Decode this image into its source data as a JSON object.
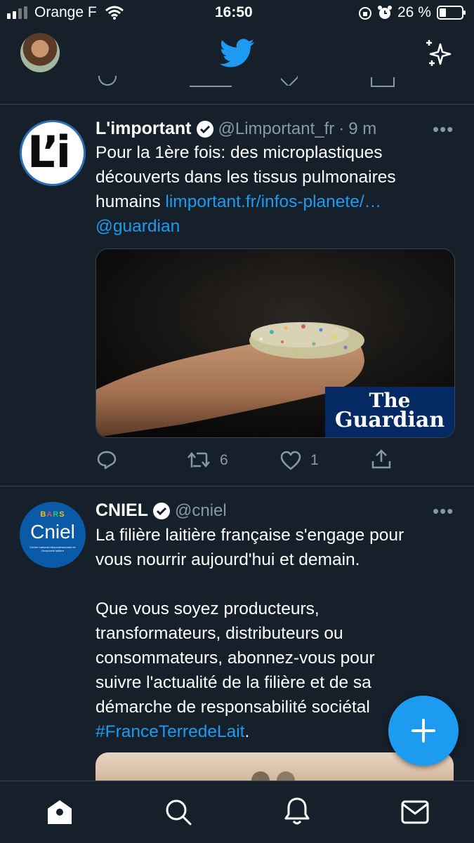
{
  "status_bar": {
    "carrier": "Orange F",
    "time": "16:50",
    "battery": "26 %"
  },
  "colors": {
    "background": "#15202b",
    "accent": "#1d9bf0",
    "divider": "#38444d",
    "secondary_text": "#8899a6"
  },
  "header": {
    "logo_icon": "twitter-bird-icon",
    "sparkle_icon": "sparkle-icon"
  },
  "tweets": [
    {
      "name": "L'important",
      "verified": true,
      "handle": "@Limportant_fr",
      "dot": "·",
      "time": "9 m",
      "more": "•••",
      "avatar_text": "L’i",
      "text_line1": "Pour la 1ère fois: des microplastiques",
      "text_line2": "découverts dans les tissus pulmonaires",
      "text_line3_plain": "humains ",
      "text_link": "limportant.fr/infos-planete/…",
      "text_mention": "@guardian",
      "media_badge_line1": "The",
      "media_badge_line2": "Guardian",
      "retweets": "6",
      "likes": "1"
    },
    {
      "name": "CNIEL",
      "verified": true,
      "handle": "@cniel",
      "more": "•••",
      "avatar_text": "Cniel",
      "avatar_sub": "Centre national interprofessionnel de l'économie laitière",
      "para1_line1": "La filière laitière française s'engage pour",
      "para1_line2": "vous nourrir aujourd'hui et demain.",
      "para2_line1": "Que vous soyez producteurs,",
      "para2_line2": "transformateurs, distributeurs ou",
      "para2_line3": "consommateurs, abonnez-vous pour",
      "para2_line4": "suivre l'actualité de la filière et de sa",
      "para2_line5": "démarche de responsabilité sociétal",
      "hashtag": "#FranceTerredeLait",
      "hashtag_after": "."
    }
  ],
  "fab": {
    "icon": "plus-icon"
  },
  "bottom_nav": [
    {
      "icon": "home-icon"
    },
    {
      "icon": "search-icon"
    },
    {
      "icon": "bell-icon"
    },
    {
      "icon": "mail-icon"
    }
  ]
}
